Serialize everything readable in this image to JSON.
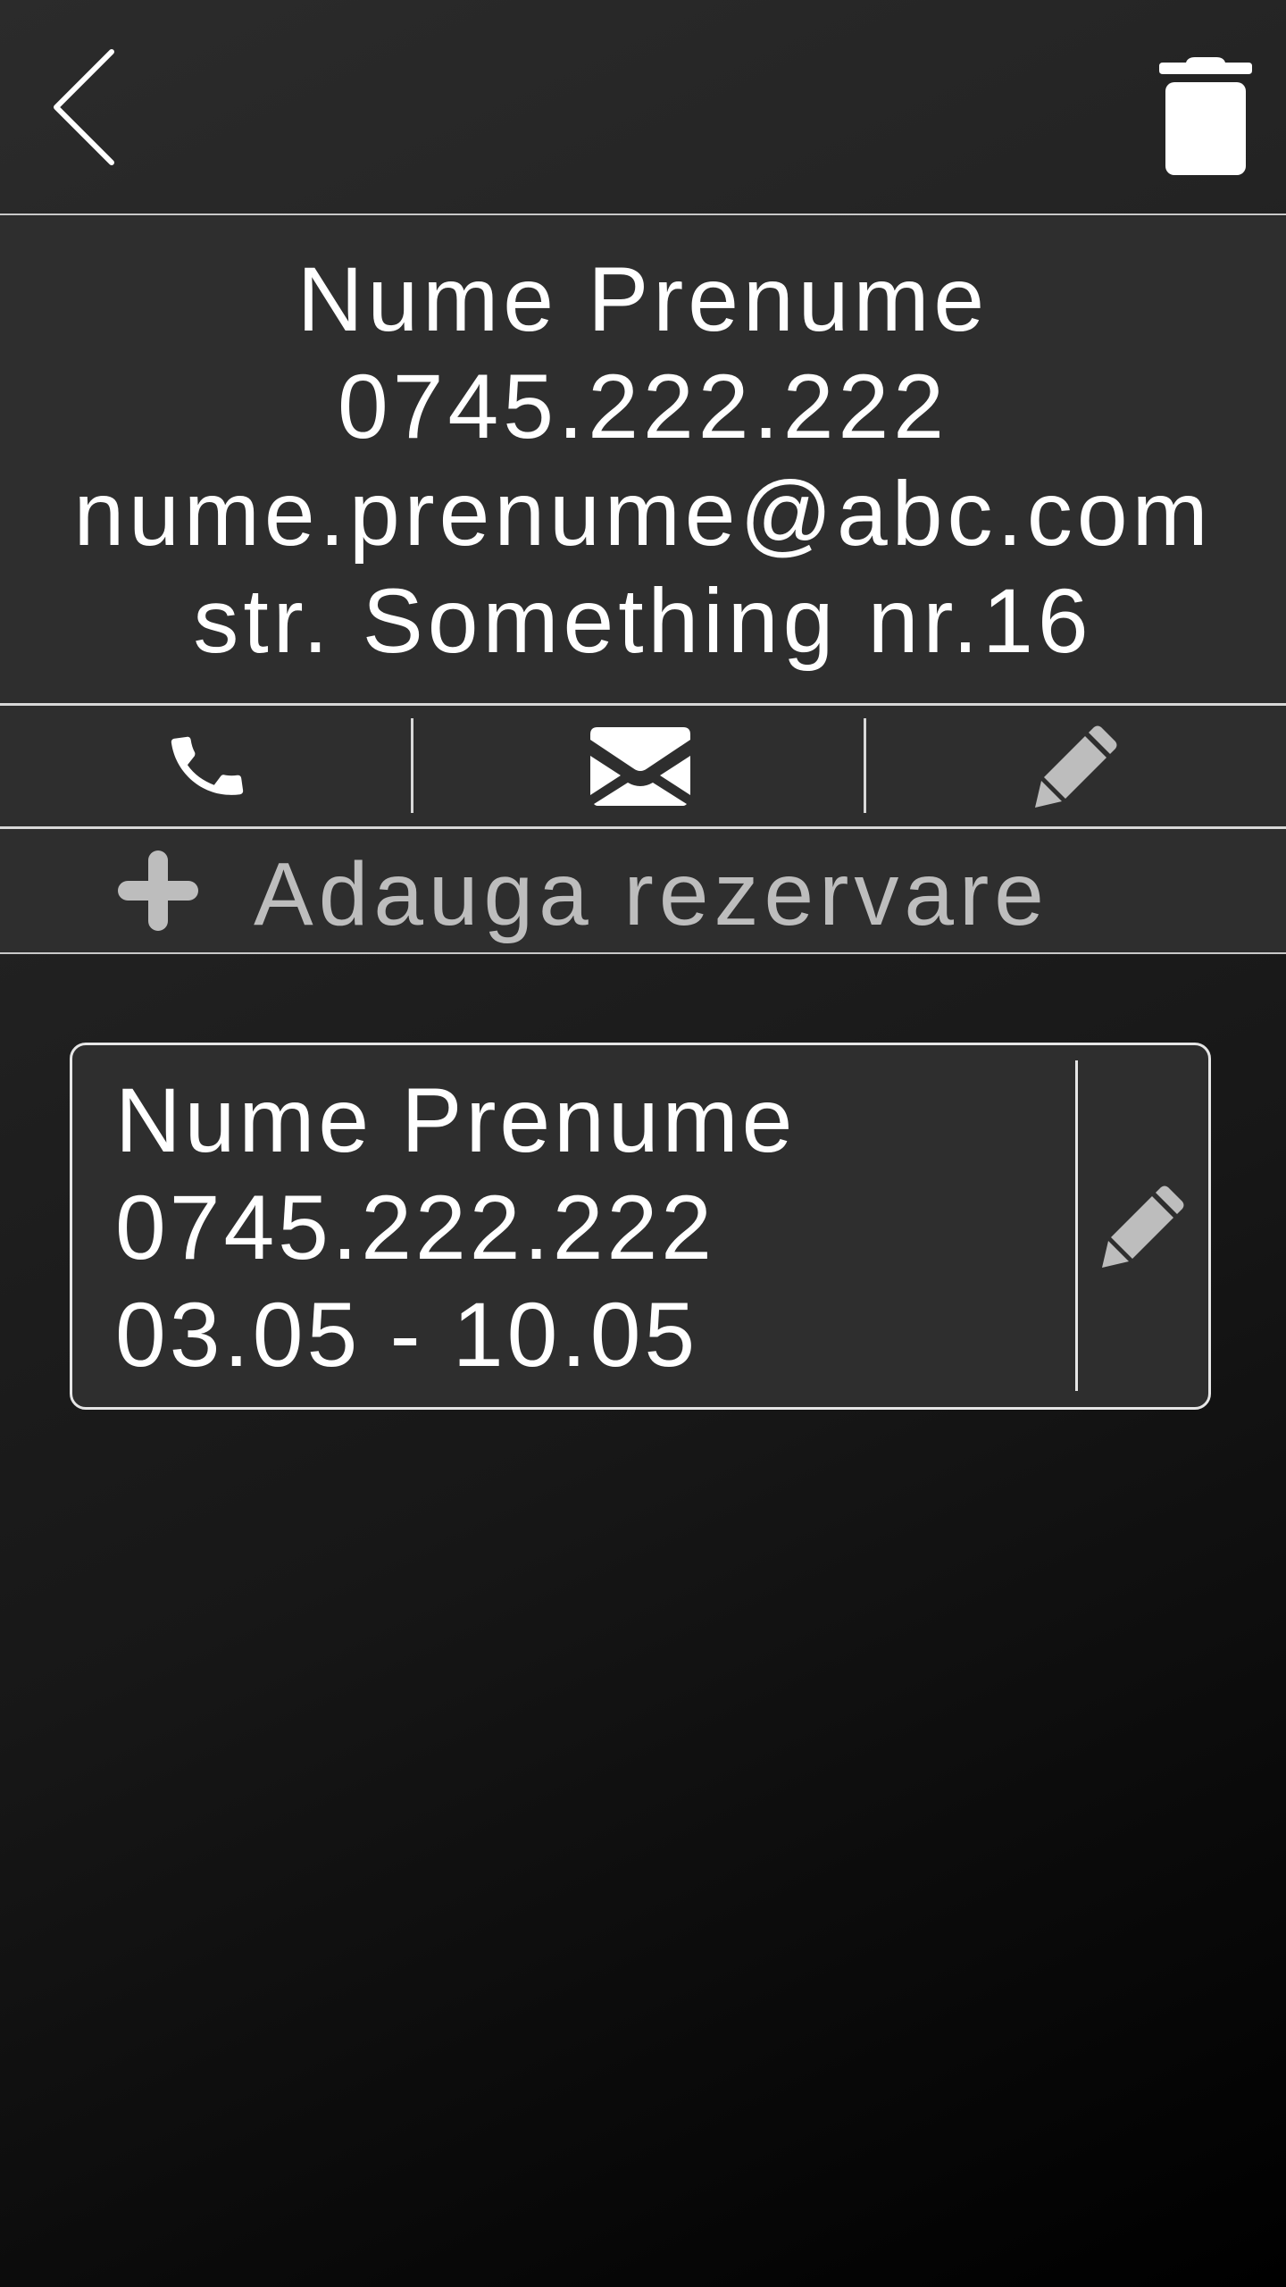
{
  "header": {
    "back_icon": "chevron-left-icon",
    "delete_icon": "trash-icon"
  },
  "contact": {
    "name": "Nume Prenume",
    "phone": "0745.222.222",
    "email": "nume.prenume@abc.com",
    "address": "str. Something nr.16"
  },
  "actions": {
    "call_icon": "phone-icon",
    "email_icon": "envelope-icon",
    "edit_icon": "pencil-icon"
  },
  "add_booking": {
    "icon": "plus-icon",
    "label": "Adauga rezervare"
  },
  "bookings": [
    {
      "name": "Nume Prenume",
      "phone": "0745.222.222",
      "dates": "03.05 - 10.05",
      "edit_icon": "pencil-icon"
    }
  ],
  "colors": {
    "text": "#ffffff",
    "muted_text": "#bdbdbd",
    "panel": "#2e2e2e",
    "divider": "#d8d8d8"
  }
}
